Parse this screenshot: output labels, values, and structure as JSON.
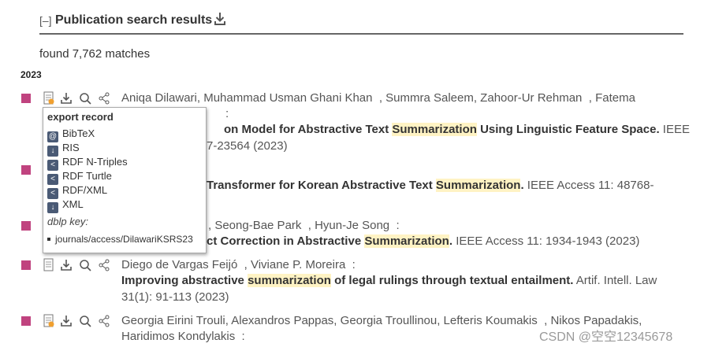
{
  "section": {
    "toggle": "[–]",
    "title": "Publication search results",
    "found_text": "found 7,762 matches",
    "year": "2023"
  },
  "entries": [
    {
      "authors_line1": "Aniqa Dilawari, Muhammad Usman Ghani Khan  , Summra Saleem, Zahoor-Ur Rehman  , Fatema",
      "authors_line2_tail": ":",
      "title_pre": "on Model for Abstractive Text ",
      "title_hl": "Summarization",
      "title_post": " Using Linguistic Feature Space.",
      "venue": " IEEE",
      "venue_line3": "7-23564 (2023)"
    },
    {
      "title_pre": "Transformer for Korean Abstractive Text ",
      "title_hl": "Summarization",
      "title_post": ".",
      "venue": " IEEE Access 11: 48768-"
    },
    {
      "authors": ", Seong-Bae Park  , Hyun-Je Song  :",
      "title_pre": "ct Correction in Abstractive ",
      "title_hl": "Summarization",
      "title_post": ".",
      "venue": " IEEE Access 11: 1934-1943 (2023)"
    },
    {
      "authors": "Diego de Vargas Feijó  , Viviane P. Moreira  :",
      "title_pre": "Improving abstractive ",
      "title_hl": "summarization",
      "title_post": " of legal rulings through textual entailment.",
      "venue": " Artif. Intell. Law",
      "venue_line3": "31(1): 91-113 (2023)"
    },
    {
      "authors": "Georgia Eirini Trouli, Alexandros Pappas, Georgia Troullinou, Lefteris Koumakis  , Nikos Papadakis,",
      "authors_line2": "Haridimos Kondylakis  :"
    }
  ],
  "export_popup": {
    "heading": "export record",
    "items": [
      "BibTeX",
      "RIS",
      "RDF N-Triples",
      "RDF Turtle",
      "RDF/XML",
      "XML"
    ],
    "key_label": "dblp key:",
    "key_value": "journals/access/DilawariKSRS23"
  },
  "watermark": "CSDN @空空12345678",
  "colors": {
    "square": "#c0437f",
    "highlight": "#fff3c4",
    "rule": "#666666"
  }
}
